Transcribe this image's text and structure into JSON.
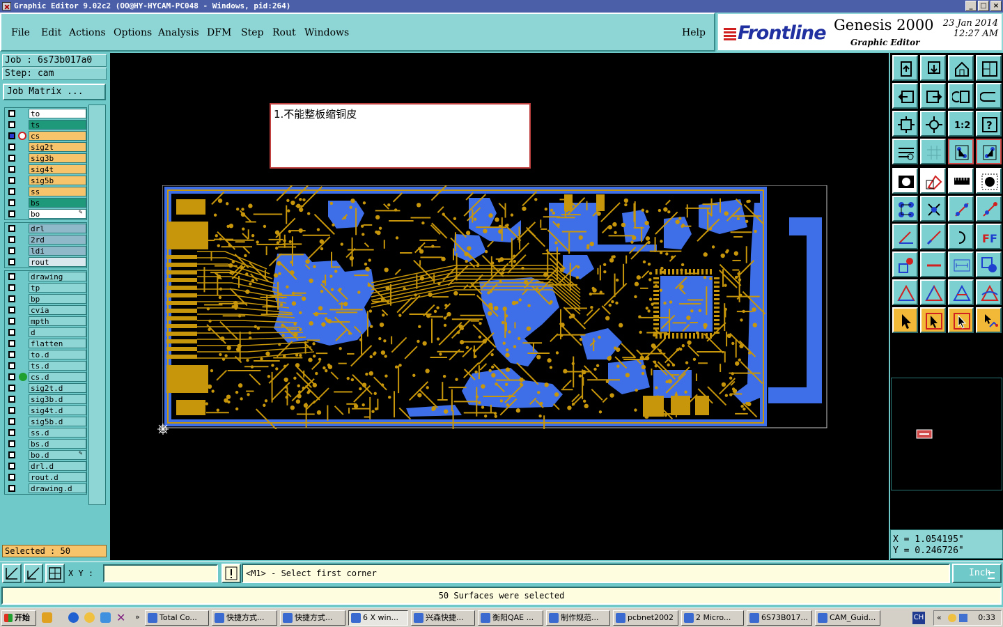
{
  "window": {
    "title": "Graphic Editor 9.02c2 (OO@HY-HYCAM-PC048 - Windows, pid:264)"
  },
  "menu": {
    "items": [
      "File",
      "Edit",
      "Actions",
      "Options",
      "Analysis",
      "DFM",
      "Step",
      "Rout",
      "Windows"
    ],
    "help": "Help"
  },
  "brand": {
    "logo": "Frontline",
    "product": "Genesis 2000",
    "subtitle": "Graphic Editor",
    "date": "23 Jan 2014",
    "time": "12:27 AM"
  },
  "job": {
    "job_line": "Job : 6s73b017a0",
    "step_line": "Step: cam",
    "matrix_button": "Job Matrix ..."
  },
  "layers": {
    "board": [
      {
        "name": "to",
        "color": "#ffffff"
      },
      {
        "name": "ts",
        "color": "#1e9a7a"
      },
      {
        "name": "cs",
        "color": "#f7c36b",
        "active": true
      },
      {
        "name": "sig2t",
        "color": "#f7c36b"
      },
      {
        "name": "sig3b",
        "color": "#f7c36b"
      },
      {
        "name": "sig4t",
        "color": "#f7c36b"
      },
      {
        "name": "sig5b",
        "color": "#f7c36b"
      },
      {
        "name": "ss",
        "color": "#f7c36b"
      },
      {
        "name": "bs",
        "color": "#1e9a7a"
      },
      {
        "name": "bo",
        "color": "#ffffff"
      }
    ],
    "drill": [
      {
        "name": "drl",
        "color": "#8fb8c8"
      },
      {
        "name": "2rd",
        "color": "#8fb8c8"
      },
      {
        "name": "ldi",
        "color": "#8fb8c8"
      },
      {
        "name": "rout",
        "color": "#d8e8ee"
      }
    ],
    "misc": [
      {
        "name": "drawing",
        "color": "#8ed6d6"
      },
      {
        "name": "tp",
        "color": "#8ed6d6"
      },
      {
        "name": "bp",
        "color": "#8ed6d6"
      },
      {
        "name": "cvia",
        "color": "#8ed6d6"
      },
      {
        "name": "mpth",
        "color": "#8ed6d6"
      },
      {
        "name": "d",
        "color": "#8ed6d6"
      },
      {
        "name": "flatten",
        "color": "#8ed6d6"
      },
      {
        "name": "to.d",
        "color": "#8ed6d6"
      },
      {
        "name": "ts.d",
        "color": "#8ed6d6"
      },
      {
        "name": "cs.d",
        "color": "#8ed6d6"
      },
      {
        "name": "sig2t.d",
        "color": "#8ed6d6"
      },
      {
        "name": "sig3b.d",
        "color": "#8ed6d6"
      },
      {
        "name": "sig4t.d",
        "color": "#8ed6d6"
      },
      {
        "name": "sig5b.d",
        "color": "#8ed6d6"
      },
      {
        "name": "ss.d",
        "color": "#8ed6d6"
      },
      {
        "name": "bs.d",
        "color": "#8ed6d6"
      },
      {
        "name": "bo.d",
        "color": "#8ed6d6"
      },
      {
        "name": "drl.d",
        "color": "#8ed6d6"
      },
      {
        "name": "rout.d",
        "color": "#8ed6d6"
      },
      {
        "name": "drawing.d",
        "color": "#8ed6d6"
      }
    ]
  },
  "selected_label": "Selected : 50",
  "note": "1.不能整板缩铜皮",
  "coords": {
    "x": "X = 1.054195\"",
    "y": "Y = 0.246726\""
  },
  "bottom": {
    "xy_label": "X Y :",
    "xy_value": "",
    "prompt": "<M1> - Select first corner",
    "unit": "Inch"
  },
  "status": "50 Surfaces were selected",
  "taskbar": {
    "start": "开始",
    "tasks": [
      "Total Co...",
      "快捷方式...",
      "快捷方式...",
      "6 X win...",
      "兴森快捷...",
      "衡阳QAE ...",
      "制作规范...",
      "pcbnet2002",
      "2 Micro...",
      "6S73B017...",
      "CAM_Guid..."
    ],
    "lang": "CH",
    "clock": "0:33"
  },
  "colors": {
    "canvas": "#000000",
    "copper": "#c8960a",
    "surface": "#3f6fe8",
    "panel": "#6fc9c9"
  }
}
